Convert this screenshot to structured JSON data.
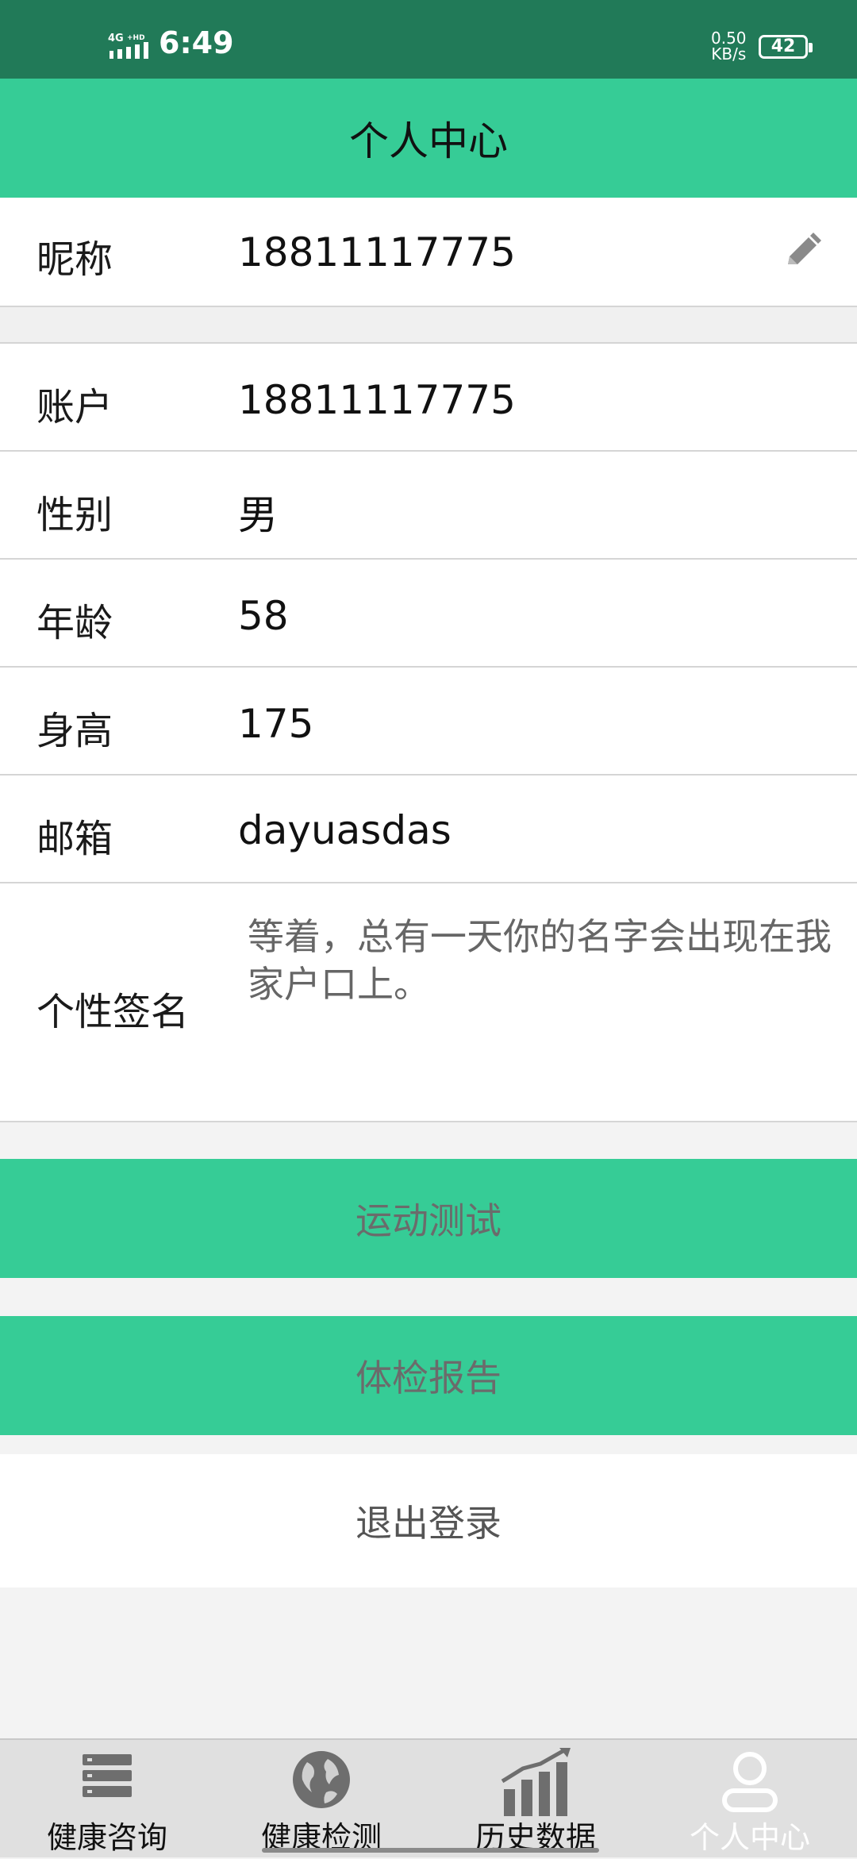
{
  "status_bar": {
    "network": "4G⁺ HD",
    "time": "6:49",
    "speed_value": "0.50",
    "speed_unit": "KB/s",
    "battery": "42"
  },
  "header": {
    "title": "个人中心"
  },
  "profile": {
    "nickname_label": "昵称",
    "nickname_value": "18811117775",
    "edit_icon": "pencil-icon",
    "account_label": "账户",
    "account_value": "18811117775",
    "gender_label": "性别",
    "gender_value": "男",
    "age_label": "年龄",
    "age_value": "58",
    "height_label": "身高",
    "height_value": "175",
    "email_label": "邮箱",
    "email_value": "dayuasdas",
    "signature_label": "个性签名",
    "signature_value": "等着，总有一天你的名字会出现在我家户口上。"
  },
  "actions": {
    "exercise_test": "运动测试",
    "checkup_report": "体检报告",
    "logout": "退出登录"
  },
  "bottom_nav": {
    "items": [
      {
        "label": "健康咨询",
        "icon": "list-icon"
      },
      {
        "label": "健康检测",
        "icon": "globe-icon"
      },
      {
        "label": "历史数据",
        "icon": "bar-chart-icon"
      },
      {
        "label": "个人中心",
        "icon": "user-icon"
      }
    ],
    "active": "个人中心"
  },
  "colors": {
    "status_bar": "#217a58",
    "accent_green": "#36cc96"
  }
}
